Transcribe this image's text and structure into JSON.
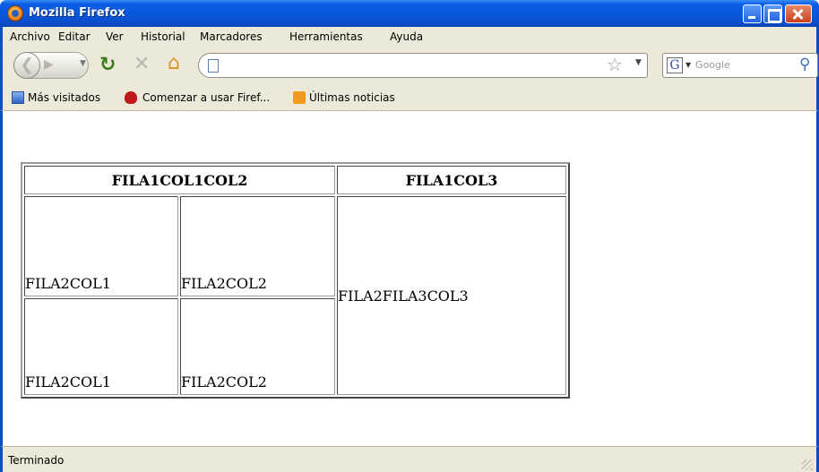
{
  "window": {
    "title": "Mozilla Firefox"
  },
  "menu": [
    "Archivo",
    "Editar",
    "Ver",
    "Historial",
    "Marcadores",
    "Herramientas",
    "Ayuda"
  ],
  "navbar": {
    "url": "",
    "search_placeholder": "Google"
  },
  "bookmarks": [
    "Más visitados",
    "Comenzar a usar Firef...",
    "Últimas noticias"
  ],
  "table": {
    "header": [
      "FILA1COL1COL2",
      "FILA1COL3"
    ],
    "rows": [
      [
        "FILA2COL1",
        "FILA2COL2",
        "FILA2FILA3COL3"
      ],
      [
        "FILA2COL1",
        "FILA2COL2"
      ]
    ]
  },
  "status": "Terminado"
}
